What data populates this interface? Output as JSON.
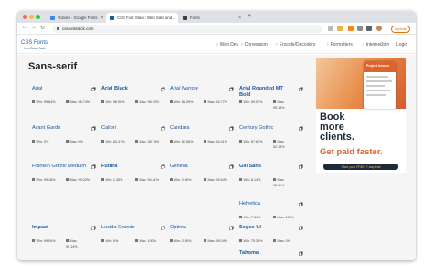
{
  "browser": {
    "tabs": [
      {
        "title": "Roboto - Google Fonts",
        "favicon_color": "#4285f4"
      },
      {
        "title": "CSS Font Stack: Web Safe and...",
        "favicon_color": "#1a5aa0"
      },
      {
        "title": "Fonts",
        "favicon_color": "#3c4043"
      }
    ],
    "url": "cssfontstack.com",
    "update_label": "Update"
  },
  "site": {
    "logo_title": "CSS Fonts",
    "logo_sub": "from Swiss Taste",
    "nav": [
      "Web Dev",
      "Conversion",
      "Encode/Decoders",
      "Formatters",
      "Internet",
      "Join",
      "Login"
    ]
  },
  "section_title": "Sans-serif",
  "fonts": [
    {
      "name": "Arial",
      "win": "Win: 99.84%",
      "mac": "Mac: 98.74%",
      "mac2": ""
    },
    {
      "name": "Arial Black",
      "win": "Win: 98.08%",
      "mac": "Mac: 96.22%",
      "mac2": ""
    },
    {
      "name": "Arial Narrow",
      "win": "Win: 88.39%",
      "mac": "Mac: 94.77%",
      "mac2": ""
    },
    {
      "name": "Arial Rounded MT Bold",
      "win": "Win: 59.53%",
      "mac": "Mac:",
      "mac2": "95.14%"
    },
    {
      "name": "Avant Garde",
      "win": "Win: 0%",
      "mac": "Mac: 0%",
      "mac2": ""
    },
    {
      "name": "Calibri",
      "win": "Win: 83.41%",
      "mac": "Mac: 38.74%",
      "mac2": ""
    },
    {
      "name": "Candara",
      "win": "Win: 83.56%",
      "mac": "Mac: 34.41%",
      "mac2": ""
    },
    {
      "name": "Century Gothic",
      "win": "Win: 87.62%",
      "mac": "Mac:",
      "mac2": "52.15%"
    },
    {
      "name": "Franklin Gothic Medium",
      "win": "Win: 99.18%",
      "mac": "Mac: 99.02%",
      "mac2": ""
    },
    {
      "name": "Futura",
      "win": "Win: 1.26%",
      "mac": "Mac: 94.41%",
      "mac2": ""
    },
    {
      "name": "Geneva",
      "win": "Win: 2.96%",
      "mac": "Mac: 99.64%",
      "mac2": ""
    },
    {
      "name": "Gill Sans",
      "win": "Win: 8.14%",
      "mac": "Mac:",
      "mac2": "95.11%"
    },
    {
      "name": "Helvetica",
      "win": "Win: 7.34%",
      "mac": "Mac: 100%",
      "mac2": ""
    },
    {
      "name": "Impact",
      "win": "Win: 99.04%",
      "mac": "Mac:",
      "mac2": "95.14%"
    },
    {
      "name": "Lucida Grande",
      "win": "Win: 0%",
      "mac": "Mac: 100%",
      "mac2": ""
    },
    {
      "name": "Optima",
      "win": "Win: 2.95%",
      "mac": "Mac: 99.04%",
      "mac2": ""
    },
    {
      "name": "Segoe UI",
      "win": "Win: 75.36%",
      "mac": "Mac: 0%",
      "mac2": ""
    },
    {
      "name": "Tahoma",
      "win": "",
      "mac": "",
      "mac2": ""
    }
  ],
  "ad": {
    "phone_label": "Project Invoice",
    "headline": [
      "Book",
      "more",
      "clients."
    ],
    "subline": [
      "Get paid faster."
    ],
    "cta": "Start your FREE 7-day trial",
    "colors": {
      "dark": "#1c2b39",
      "orange": "#e0632d",
      "accent": "#ffb25c"
    }
  },
  "colors": {
    "link": "#1a5aa0",
    "tab_bg": "#dee1e6",
    "update": "#e8710a"
  }
}
